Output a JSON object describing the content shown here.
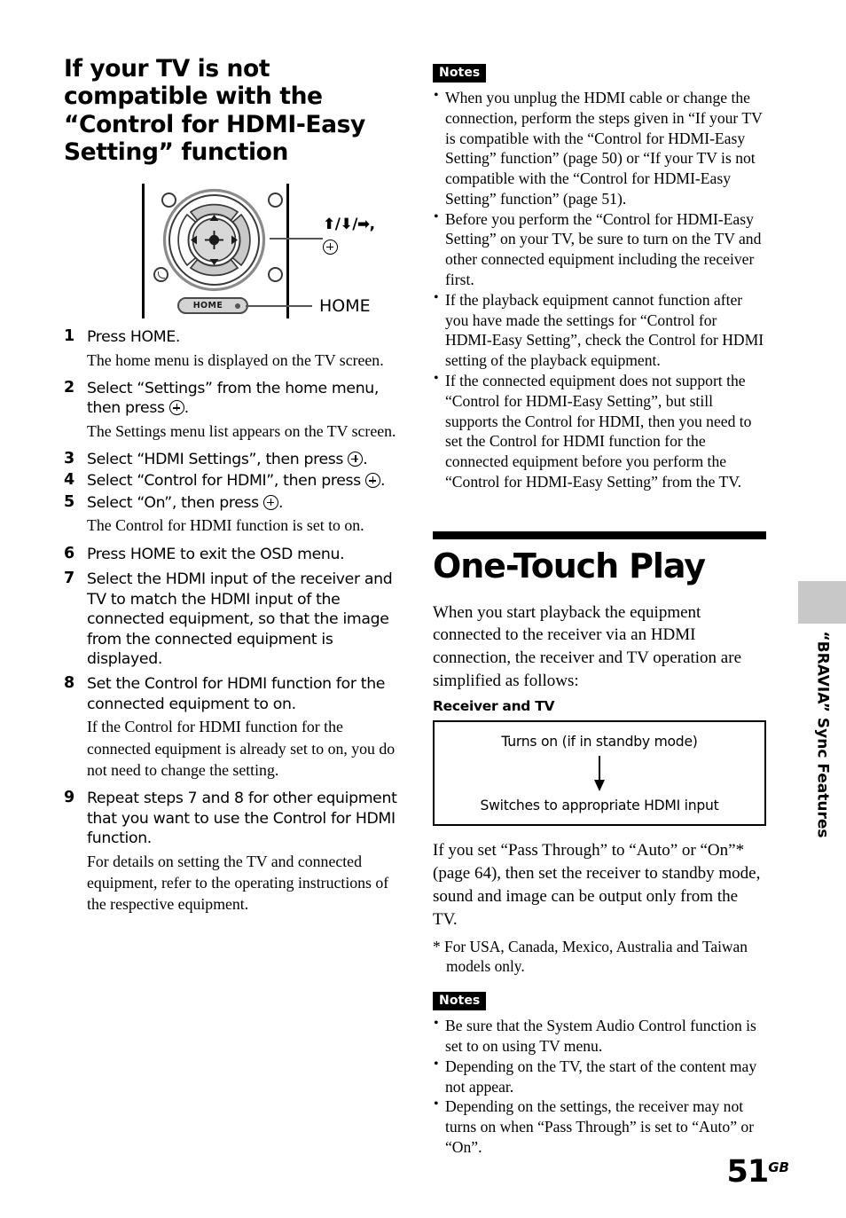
{
  "page": {
    "number": "51",
    "region_code": "GB"
  },
  "side_tab": {
    "label": "“BRAVIA” Sync Features",
    "tab_color": "#c8c8c8"
  },
  "left_column": {
    "section_title": "If your TV is not compatible with the “Control for HDMI-Easy Setting” function",
    "figure": {
      "home_button_label": "HOME",
      "callout_arrows": "⬆/⬇/➡,",
      "callout_plus_icon": "circled-plus-icon",
      "callout_home": "HOME"
    },
    "steps": [
      {
        "num": "1",
        "head": "Press HOME.",
        "body": "The home menu is displayed on the TV screen."
      },
      {
        "num": "2",
        "head_pre": "Select “Settings” from the home menu, then press",
        "head_post": ".",
        "has_plus": true,
        "body": "The Settings menu list appears on the TV screen."
      },
      {
        "num": "3",
        "head_pre": "Select “HDMI Settings”, then press",
        "head_post": ".",
        "has_plus": true,
        "body": ""
      },
      {
        "num": "4",
        "head_pre": "Select “Control for HDMI”, then press",
        "head_post": ".",
        "has_plus": true,
        "body": ""
      },
      {
        "num": "5",
        "head_pre": "Select “On”, then press",
        "head_post": ".",
        "has_plus": true,
        "body": "The Control for HDMI function is set to on."
      },
      {
        "num": "6",
        "head": "Press HOME to exit the OSD menu.",
        "body": ""
      },
      {
        "num": "7",
        "head": "Select the HDMI input of the receiver and TV to match the HDMI input of the connected equipment, so that the image from the connected equipment is displayed.",
        "body": ""
      },
      {
        "num": "8",
        "head": "Set the Control for HDMI function for the connected equipment to on.",
        "body": "If the Control for HDMI function for the connected equipment is already set to on, you do not need to change the setting."
      },
      {
        "num": "9",
        "head": "Repeat steps 7 and 8 for other equipment that you want to use the Control for HDMI function.",
        "body": "For details on setting the TV and connected equipment, refer to the operating instructions of the respective equipment."
      }
    ]
  },
  "right_column": {
    "notes_top": {
      "label": "Notes",
      "items": [
        "When you unplug the HDMI cable or change the connection, perform the steps given in “If your TV is compatible with the “Control for HDMI-Easy Setting” function” (page 50) or “If your TV is not compatible with the “Control for HDMI-Easy Setting” function” (page 51).",
        "Before you perform the “Control for HDMI-Easy Setting” on your TV, be sure to turn on the TV and other connected equipment including the receiver first.",
        "If the playback equipment cannot function after you have made the settings for “Control for HDMI-Easy Setting”, check the Control for HDMI setting of the playback equipment.",
        "If the connected equipment does not support the “Control for HDMI-Easy Setting”, but still supports the Control for HDMI, then you need to set the Control for HDMI function for the connected equipment before you perform the “Control for HDMI-Easy Setting” from the TV."
      ]
    },
    "chapter": {
      "title": "One-Touch Play",
      "intro": "When you start playback the equipment connected to the receiver via an HDMI connection, the receiver and TV operation are simplified as follows:",
      "subheading": "Receiver and TV",
      "flow_box": {
        "step1": "Turns on (if in standby mode)",
        "arrow": "down-arrow-icon",
        "step2": "Switches to appropriate HDMI input"
      },
      "after_box": "If you set “Pass Through” to “Auto” or “On”* (page 64), then set the receiver to standby mode, sound and image can be output only from the TV.",
      "footnote": "* For USA, Canada, Mexico, Australia and Taiwan models only."
    },
    "notes_bottom": {
      "label": "Notes",
      "items": [
        "Be sure that the System Audio Control function is set to on using TV menu.",
        "Depending on the TV, the start of the content may not appear.",
        "Depending on the settings, the receiver may not turns on when “Pass Through” is set to “Auto” or “On”."
      ]
    }
  }
}
